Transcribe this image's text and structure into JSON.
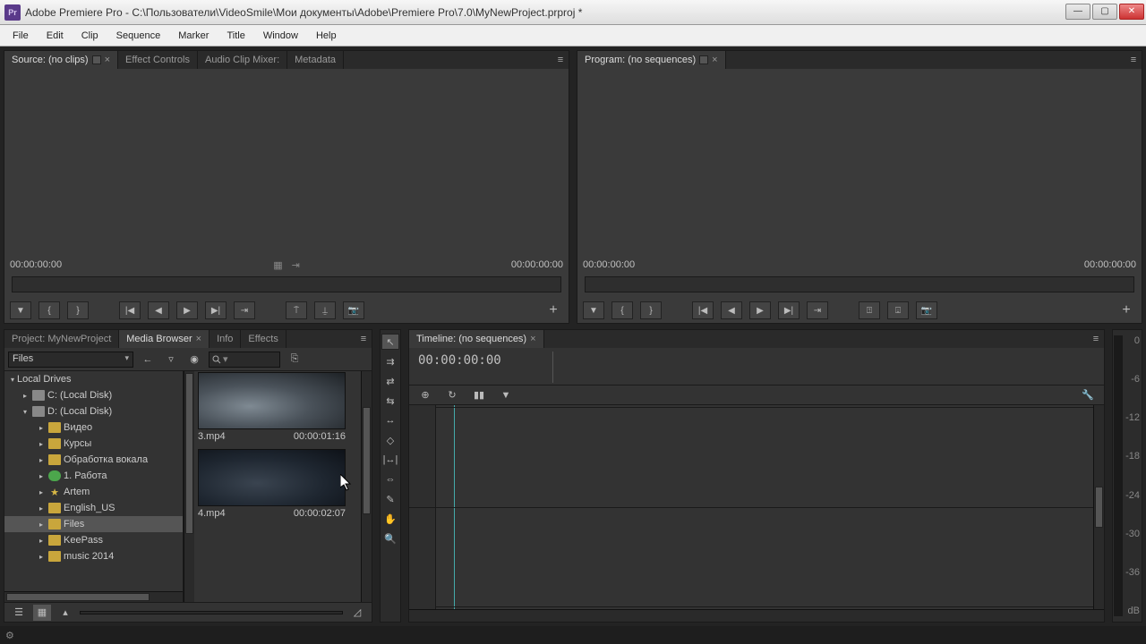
{
  "titlebar": {
    "icon_text": "Pr",
    "title": "Adobe Premiere Pro - С:\\Пользователи\\VideoSmile\\Мои документы\\Adobe\\Premiere Pro\\7.0\\MyNewProject.prproj *"
  },
  "menubar": [
    "File",
    "Edit",
    "Clip",
    "Sequence",
    "Marker",
    "Title",
    "Window",
    "Help"
  ],
  "source": {
    "tabs": {
      "source": "Source: (no clips)",
      "effects": "Effect Controls",
      "mixer": "Audio Clip Mixer:",
      "metadata": "Metadata"
    },
    "tc_left": "00:00:00:00",
    "tc_right": "00:00:00:00"
  },
  "program": {
    "tabs": {
      "program": "Program: (no sequences)"
    },
    "tc_left": "00:00:00:00",
    "tc_right": "00:00:00:00"
  },
  "project": {
    "tabs": {
      "project": "Project: MyNewProject",
      "media": "Media Browser",
      "info": "Info",
      "effects": "Effects"
    },
    "dropdown": "Files",
    "tree": {
      "root": "Local Drives",
      "c_drive": "C: (Local Disk)",
      "d_drive": "D: (Local Disk)",
      "items": [
        "Видео",
        "Курсы",
        "Обработка вокала",
        "1. Работа",
        "Artem",
        "English_US",
        "Files",
        "KeePass",
        "music 2014"
      ]
    },
    "clips": [
      {
        "name": "3.mp4",
        "duration": "00:00:01:16"
      },
      {
        "name": "4.mp4",
        "duration": "00:00:02:07"
      }
    ]
  },
  "timeline": {
    "tab": "Timeline: (no sequences)",
    "tc": "00:00:00:00"
  },
  "meters": {
    "ticks": [
      "0",
      "-6",
      "-12",
      "-18",
      "-24",
      "-30",
      "-36",
      "  dB"
    ]
  }
}
